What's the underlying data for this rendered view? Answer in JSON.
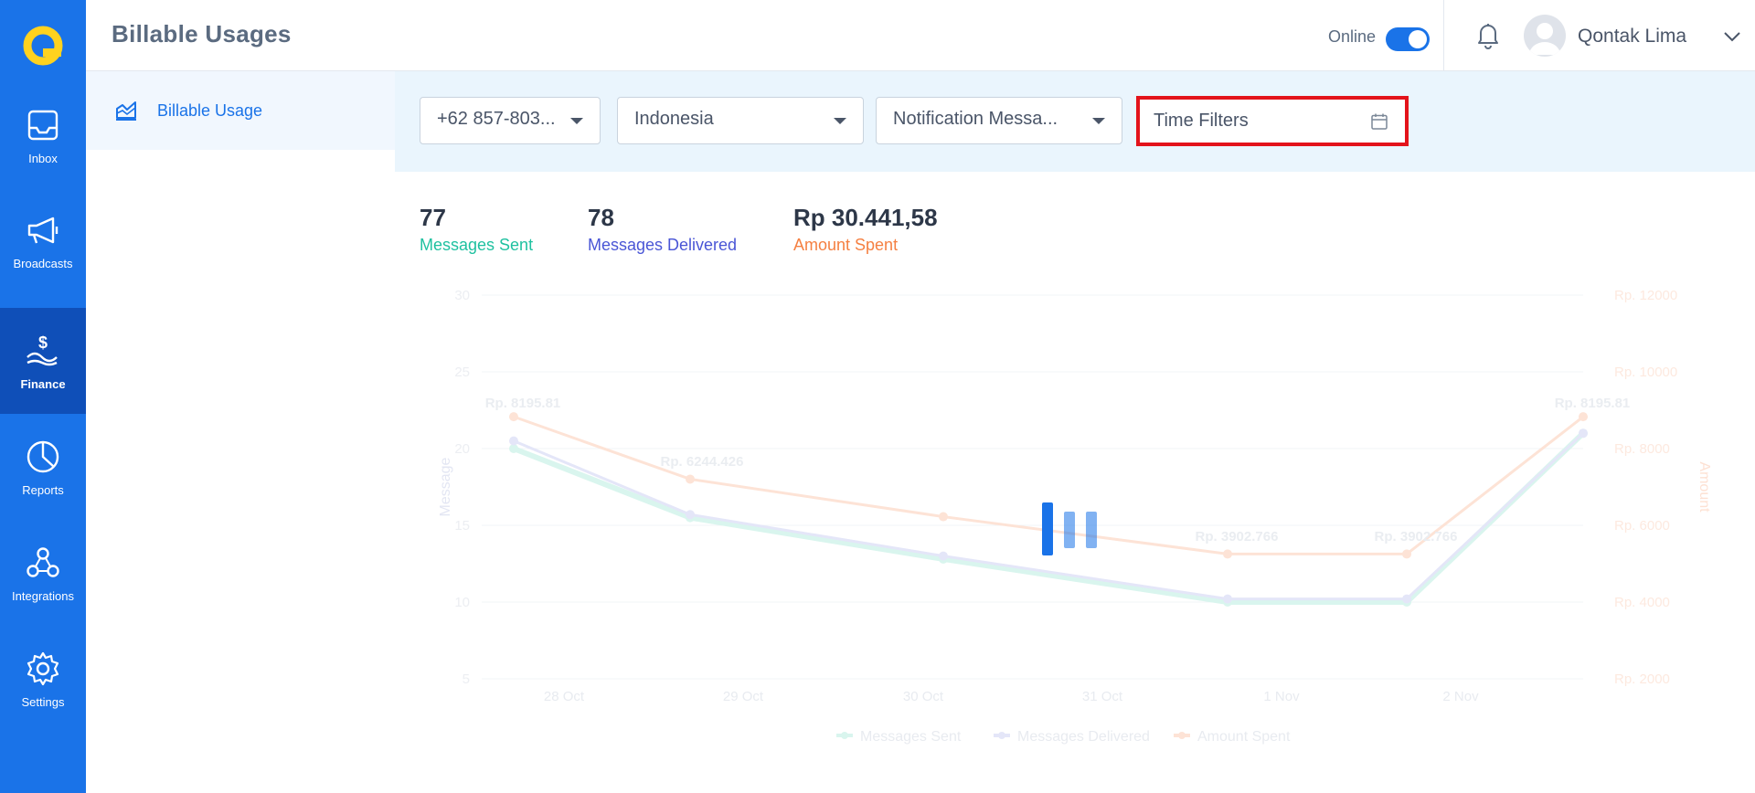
{
  "nav": {
    "items": [
      {
        "label": "Inbox",
        "icon": "inbox-icon"
      },
      {
        "label": "Broadcasts",
        "icon": "megaphone-icon"
      },
      {
        "label": "Finance",
        "icon": "finance-icon",
        "active": true
      },
      {
        "label": "Reports",
        "icon": "pie-chart-icon"
      },
      {
        "label": "Integrations",
        "icon": "integrations-icon"
      },
      {
        "label": "Settings",
        "icon": "gear-icon"
      }
    ]
  },
  "header": {
    "title": "Billable Usages",
    "online_label": "Online",
    "online": true,
    "user_name": "Qontak Lima"
  },
  "subnav": {
    "item_label": "Billable Usage"
  },
  "filters": {
    "phone": "+62 857-803...",
    "country": "Indonesia",
    "message_type": "Notification Messa...",
    "time_placeholder": "Time Filters"
  },
  "stats": {
    "sent_value": "77",
    "sent_label": "Messages Sent",
    "delivered_value": "78",
    "delivered_label": "Messages Delivered",
    "amount_value": "Rp 30.441,58",
    "amount_label": "Amount Spent"
  },
  "colors": {
    "brand": "#1a73e8",
    "sent": "#1fc1a0",
    "delivered": "#4a56d6",
    "amount": "#f58042",
    "highlight": "#e3131b"
  },
  "chart_data": {
    "type": "line",
    "categories": [
      "28 Oct",
      "29 Oct",
      "30 Oct",
      "31 Oct",
      "1 Nov",
      "2 Nov"
    ],
    "ylabel": "Message",
    "y2label": "Amount",
    "ylim": [
      5,
      30
    ],
    "yticks": [
      "5",
      "10",
      "15",
      "20",
      "25",
      "30"
    ],
    "y2ticks": [
      "Rp. 2000",
      "Rp. 4000",
      "Rp. 6000",
      "Rp. 8000",
      "Rp. 10000",
      "Rp. 12000"
    ],
    "series": [
      {
        "name": "Messages Sent",
        "values": [
          20,
          15.5,
          12.8,
          10,
          10,
          21
        ]
      },
      {
        "name": "Messages Delivered",
        "values": [
          20.5,
          15.7,
          13,
          10.2,
          10.2,
          21
        ]
      },
      {
        "name": "Amount Spent",
        "values": [
          8195.81,
          6244.426,
          5070,
          3902.766,
          3902.766,
          8195.81
        ]
      }
    ],
    "data_labels": [
      "Rp. 8195.81",
      "Rp. 6244.426",
      "Rp. 3902.766",
      "Rp. 3902.766",
      "Rp. 8195.81"
    ],
    "legend": "bottom",
    "faded": true
  }
}
